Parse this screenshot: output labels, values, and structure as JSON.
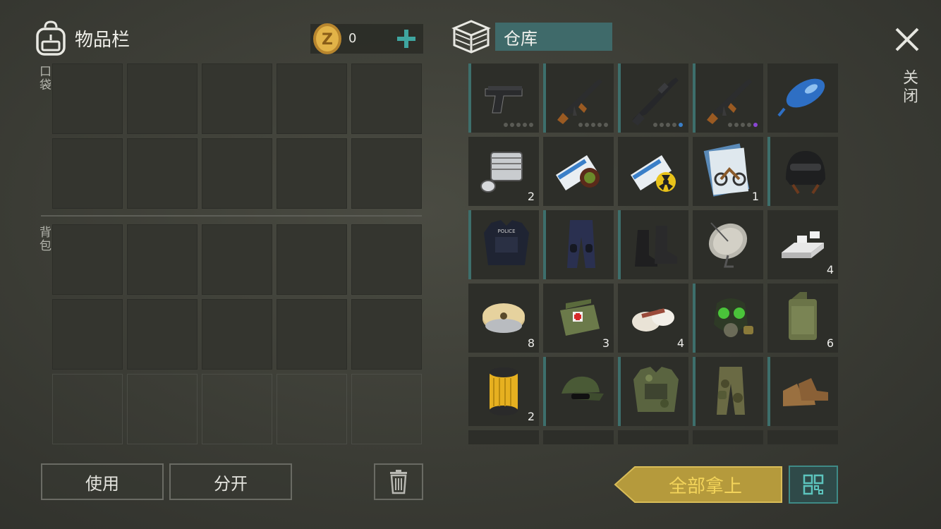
{
  "inventory": {
    "title": "物品栏",
    "pocket_label": "口袋",
    "backpack_label": "背包",
    "coins": "0"
  },
  "storage": {
    "title": "仓库",
    "items": [
      {
        "icon": "pistol-icon",
        "qty": "",
        "equip": true,
        "dots": [
          "#5a5b55",
          "#5a5b55",
          "#5a5b55",
          "#5a5b55",
          "#5a5b55"
        ]
      },
      {
        "icon": "ak-rifle-icon",
        "qty": "",
        "equip": true,
        "dots": [
          "#5a5b55",
          "#5a5b55",
          "#5a5b55",
          "#5a5b55",
          "#5a5b55"
        ]
      },
      {
        "icon": "m16-rifle-icon",
        "qty": "",
        "equip": true,
        "dots": [
          "#5a5b55",
          "#5a5b55",
          "#5a5b55",
          "#5a5b55",
          "#3a7fc8"
        ]
      },
      {
        "icon": "ak-rifle-icon",
        "qty": "",
        "equip": true,
        "dots": [
          "#5a5b55",
          "#5a5b55",
          "#5a5b55",
          "#5a5b55",
          "#8a46d4"
        ]
      },
      {
        "icon": "fuel-tank-icon",
        "qty": "",
        "equip": false
      },
      {
        "icon": "engine-cylinder-icon",
        "qty": "2",
        "equip": false
      },
      {
        "icon": "magazine-scroll-icon",
        "qty": "",
        "equip": false
      },
      {
        "icon": "radioactive-magazine-icon",
        "qty": "",
        "equip": false
      },
      {
        "icon": "blueprint-motorcycle-icon",
        "qty": "1",
        "equip": false
      },
      {
        "icon": "helmet-icon",
        "qty": "",
        "equip": true
      },
      {
        "icon": "police-vest-icon",
        "qty": "",
        "equip": true
      },
      {
        "icon": "police-pants-icon",
        "qty": "",
        "equip": true
      },
      {
        "icon": "boots-icon",
        "qty": "",
        "equip": true
      },
      {
        "icon": "satellite-dish-icon",
        "qty": "",
        "equip": false
      },
      {
        "icon": "metal-ingot-icon",
        "qty": "4",
        "equip": false
      },
      {
        "icon": "wire-spool-icon",
        "qty": "8",
        "equip": false
      },
      {
        "icon": "medkit-bag-icon",
        "qty": "3",
        "equip": false
      },
      {
        "icon": "bandage-icon",
        "qty": "4",
        "equip": false
      },
      {
        "icon": "gas-mask-icon",
        "qty": "",
        "equip": true
      },
      {
        "icon": "jerrycan-icon",
        "qty": "6",
        "equip": false
      },
      {
        "icon": "oil-filter-icon",
        "qty": "2",
        "equip": false
      },
      {
        "icon": "camo-cap-icon",
        "qty": "",
        "equip": true
      },
      {
        "icon": "camo-vest-icon",
        "qty": "",
        "equip": true
      },
      {
        "icon": "camo-pants-icon",
        "qty": "",
        "equip": true
      },
      {
        "icon": "desert-boots-icon",
        "qty": "",
        "equip": true
      },
      {
        "icon": "spray-can-icon",
        "qty": "",
        "equip": false
      },
      {
        "icon": "misc-item-icon",
        "qty": "",
        "equip": false
      },
      {
        "icon": "misc-item-icon",
        "qty": "",
        "equip": false
      },
      {
        "icon": "misc-item-icon",
        "qty": "",
        "equip": false
      },
      {
        "icon": "misc-item-icon",
        "qty": "",
        "equip": false
      }
    ]
  },
  "actions": {
    "use": "使用",
    "split": "分开",
    "take_all": "全部拿上",
    "close": "关闭"
  },
  "colors": {
    "accent_teal": "#3f6a6a",
    "take_all_gold": "#b59a3c",
    "take_all_text": "#f3d45a"
  }
}
